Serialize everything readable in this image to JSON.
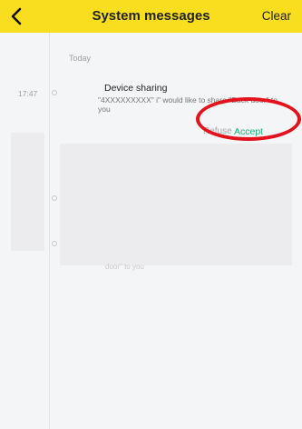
{
  "header": {
    "title": "System messages",
    "clear_label": "Clear",
    "back_icon": "chevron-left-icon",
    "background": "#f9dd1f"
  },
  "timeline": {
    "date_label": "Today",
    "messages": [
      {
        "time": "17:47",
        "title": "Device sharing",
        "body": "\"4XXXXXXXXX\" i\" would like to share \"Back door\" to you",
        "refuse_label": "Refuse",
        "accept_label": "Accept"
      }
    ],
    "ghost_text": "door\" to you"
  },
  "colors": {
    "accent": "#20b57a",
    "highlight": "#e3121c",
    "background": "#f4f5f7"
  }
}
